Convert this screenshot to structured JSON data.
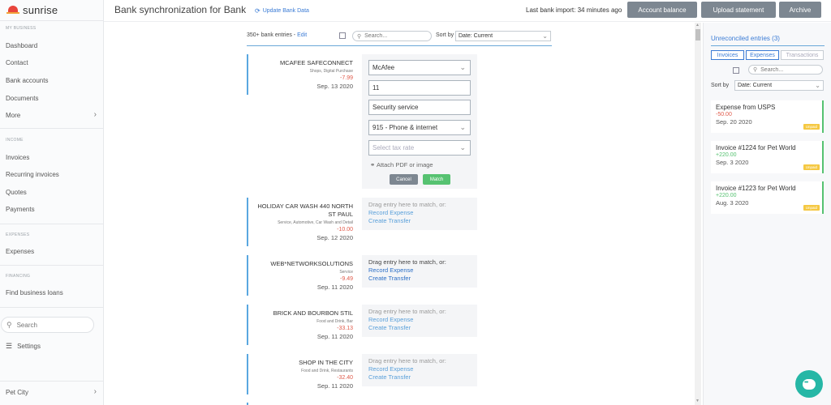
{
  "app": {
    "logo_text": "sunrise"
  },
  "sidebar": {
    "sections": {
      "business": "MY BUSINESS",
      "income": "INCOME",
      "expenses": "EXPENSES",
      "financing": "FINANCING"
    },
    "items": {
      "dashboard": "Dashboard",
      "contact": "Contact",
      "bank_accounts": "Bank accounts",
      "documents": "Documents",
      "more": "More",
      "invoices": "Invoices",
      "recurring_invoices": "Recurring invoices",
      "quotes": "Quotes",
      "payments": "Payments",
      "expenses": "Expenses",
      "find_loans": "Find business loans",
      "settings": "Settings",
      "company": "Pet City"
    },
    "search_placeholder": "Search"
  },
  "topbar": {
    "title": "Bank synchronization for Bank",
    "update_link": "Update Bank Data",
    "last_import": "Last bank import: 34 minutes ago",
    "buttons": {
      "account_balance": "Account balance",
      "upload_statement": "Upload statement",
      "archive": "Archive"
    }
  },
  "main": {
    "entries_count": "350+ bank entries - ",
    "edit": "Edit",
    "search_placeholder": "Search...",
    "sort_label": "Sort by",
    "sort_value": "Date: Current",
    "entries": [
      {
        "name": "MCAFEE SAFECONNECT",
        "category": "Shops, Digital Purchase",
        "amount": "-7.99",
        "date": "Sep. 13 2020"
      },
      {
        "name": "HOLIDAY CAR WASH 440 NORTH ST PAUL",
        "category": "Service, Automotive, Car Wash and Detail",
        "amount": "-10.00",
        "date": "Sep. 12 2020"
      },
      {
        "name": "WEB*NETWORKSOLUTIONS",
        "category": "Service",
        "amount": "-9.49",
        "date": "Sep. 11 2020"
      },
      {
        "name": "BRICK AND BOURBON STIL",
        "category": "Food and Drink, Bar",
        "amount": "-33.13",
        "date": "Sep. 11 2020"
      },
      {
        "name": "SHOP IN THE CITY",
        "category": "Food and Drink, Restaurants",
        "amount": "-32.40",
        "date": "Sep. 11 2020"
      }
    ],
    "match_form": {
      "vendor": "McAfee",
      "number": "11",
      "description": "Security service",
      "account": "915 - Phone & internet",
      "tax_placeholder": "Select tax rate",
      "attach": "Attach PDF or image",
      "cancel": "Cancel",
      "match": "Match"
    },
    "drop_zone": {
      "hint": "Drag entry here to match, or:",
      "record_expense": "Record Expense",
      "create_transfer": "Create Transfer"
    }
  },
  "right_panel": {
    "title": "Unreconciled entries (3)",
    "tabs": {
      "invoices": "Invoices",
      "expenses": "Expenses",
      "transactions": "Transactions"
    },
    "search_placeholder": "Search...",
    "sort_label": "Sort by",
    "sort_value": "Date: Current",
    "cards": [
      {
        "title": "Expense from USPS",
        "amount": "-50.00",
        "date": "Sep. 20 2020",
        "badge": "Unpaid"
      },
      {
        "title": "Invoice #1224 for Pet World",
        "amount": "+220.00",
        "date": "Sep. 3 2020",
        "badge": "Unpaid"
      },
      {
        "title": "Invoice #1223 for Pet World",
        "amount": "+220.00",
        "date": "Aug. 3 2020",
        "badge": "Unpaid"
      }
    ]
  },
  "colors": {
    "accent": "#3a7bd5",
    "negative": "#e05a4a",
    "positive": "#56c271",
    "badge": "#f5c842",
    "chat": "#26b7a6"
  }
}
